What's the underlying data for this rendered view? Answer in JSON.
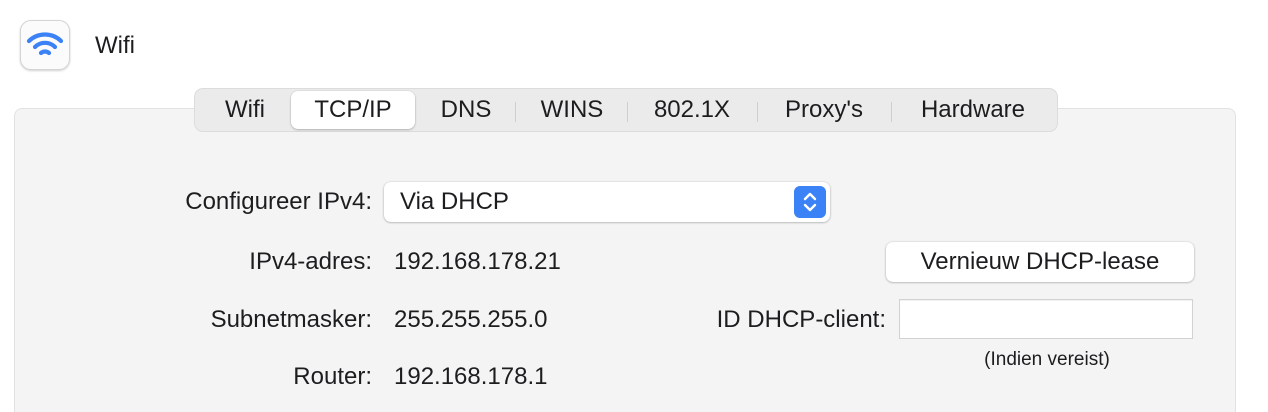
{
  "header": {
    "app_icon": "wifi-icon",
    "title": "Wifi",
    "accent_color": "#3a82f6"
  },
  "tabs": [
    {
      "label": "Wifi",
      "selected": false
    },
    {
      "label": "TCP/IP",
      "selected": true
    },
    {
      "label": "DNS",
      "selected": false
    },
    {
      "label": "WINS",
      "selected": false
    },
    {
      "label": "802.1X",
      "selected": false
    },
    {
      "label": "Proxy's",
      "selected": false
    },
    {
      "label": "Hardware",
      "selected": false
    }
  ],
  "form": {
    "configure_ipv4_label": "Configureer IPv4:",
    "configure_ipv4_value": "Via DHCP",
    "configure_ipv4_stepper_icon": "up-down-chevron-icon",
    "ipv4_address_label": "IPv4-adres:",
    "ipv4_address_value": "192.168.178.21",
    "subnet_mask_label": "Subnetmasker:",
    "subnet_mask_value": "255.255.255.0",
    "router_label": "Router:",
    "router_value": "192.168.178.1",
    "renew_button_label": "Vernieuw DHCP-lease",
    "dhcp_client_id_label": "ID DHCP-client:",
    "dhcp_client_id_value": "",
    "dhcp_client_id_hint": "(Indien vereist)"
  }
}
